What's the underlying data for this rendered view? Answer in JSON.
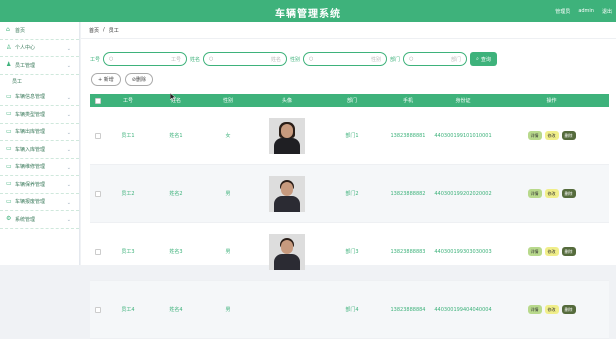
{
  "header": {
    "title": "车辆管理系统",
    "links": [
      "管理员",
      "admin",
      "退出"
    ]
  },
  "sidebar": {
    "items": [
      {
        "icon": "home-icon",
        "label": "首页",
        "expandable": false
      },
      {
        "icon": "user-icon",
        "label": "个人中心",
        "expandable": true
      },
      {
        "icon": "people-icon",
        "label": "员工管理",
        "expandable": true,
        "sub": "员工"
      },
      {
        "icon": "car-icon",
        "label": "车辆信息管理",
        "expandable": true
      },
      {
        "icon": "car-icon",
        "label": "车辆类型管理",
        "expandable": true
      },
      {
        "icon": "car-icon",
        "label": "车辆出库管理",
        "expandable": true
      },
      {
        "icon": "car-icon",
        "label": "车辆入库管理",
        "expandable": true
      },
      {
        "icon": "car-icon",
        "label": "车辆维修管理",
        "expandable": true
      },
      {
        "icon": "car-icon",
        "label": "车辆保养管理",
        "expandable": true
      },
      {
        "icon": "car-icon",
        "label": "车辆报废管理",
        "expandable": true
      },
      {
        "icon": "gear-icon",
        "label": "系统管理",
        "expandable": true
      }
    ]
  },
  "breadcrumb": {
    "root": "首页",
    "sep": "/",
    "current": "员工"
  },
  "search": {
    "fields": [
      {
        "label": "工号",
        "placeholder": "工号"
      },
      {
        "label": "姓名",
        "placeholder": "姓名"
      },
      {
        "label": "性别",
        "placeholder": "性别"
      },
      {
        "label": "部门",
        "placeholder": "部门"
      }
    ],
    "query_label": "查询"
  },
  "actions": {
    "add": "+ 新增",
    "delete": "删除"
  },
  "table": {
    "headers": [
      "",
      "工号",
      "姓名",
      "性别",
      "头像",
      "部门",
      "手机",
      "身份证",
      "操作"
    ],
    "rows": [
      {
        "id": "员工1",
        "name": "姓名1",
        "gender": "女",
        "dept": "部门1",
        "phone": "13823888881",
        "idcard": "440300199101010001",
        "photo": "female"
      },
      {
        "id": "员工2",
        "name": "姓名2",
        "gender": "男",
        "dept": "部门2",
        "phone": "13823888882",
        "idcard": "440300199202020002",
        "photo": "male"
      },
      {
        "id": "员工3",
        "name": "姓名3",
        "gender": "男",
        "dept": "部门3",
        "phone": "13823888883",
        "idcard": "440300199303030003",
        "photo": "male"
      },
      {
        "id": "员工4",
        "name": "姓名4",
        "gender": "男",
        "dept": "部门4",
        "phone": "13823888884",
        "idcard": "440300199404040004",
        "photo": ""
      }
    ],
    "ops": {
      "detail": "详情",
      "edit": "修改",
      "delete": "删除"
    }
  },
  "colors": {
    "accent": "#3eb27b"
  }
}
